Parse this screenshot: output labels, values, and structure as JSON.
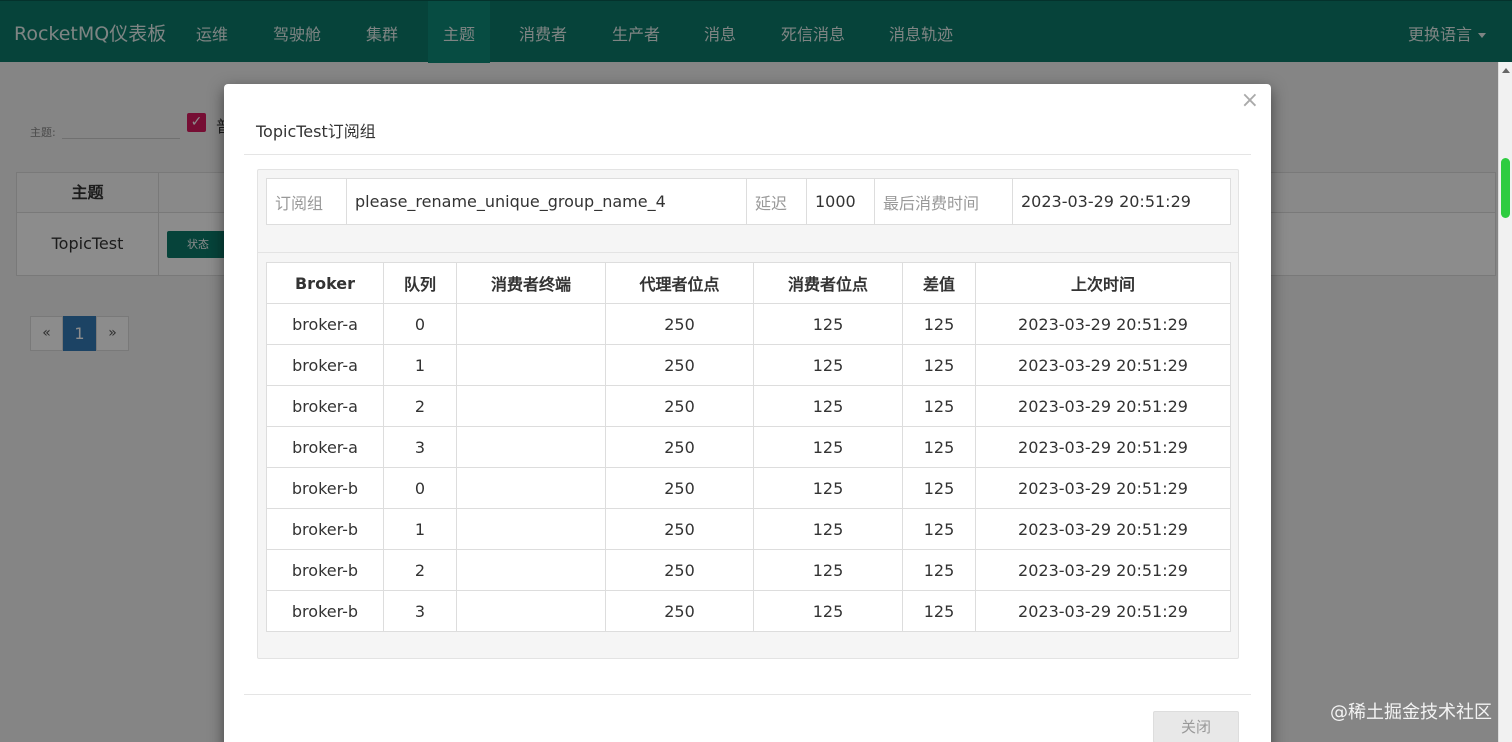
{
  "navbar": {
    "brand": "RocketMQ仪表板",
    "items": [
      "运维",
      "驾驶舱",
      "集群",
      "主题",
      "消费者",
      "生产者",
      "消息",
      "死信消息",
      "消息轨迹"
    ],
    "active_index": 3,
    "language": "更换语言"
  },
  "background": {
    "search_label": "主题:",
    "checkbox_label": "普",
    "table_header": "主题",
    "topic_name": "TopicTest",
    "status_button": "状态",
    "pagination": {
      "prev": "«",
      "current": "1",
      "next": "»"
    }
  },
  "modal": {
    "title": "TopicTest订阅组",
    "close_symbol": "×",
    "info": {
      "group_label": "订阅组",
      "group_value": "please_rename_unique_group_name_4",
      "delay_label": "延迟",
      "delay_value": "1000",
      "last_consume_label": "最后消费时间",
      "last_consume_value": "2023-03-29 20:51:29"
    },
    "columns": [
      "Broker",
      "队列",
      "消费者终端",
      "代理者位点",
      "消费者位点",
      "差值",
      "上次时间"
    ],
    "rows": [
      [
        "broker-a",
        "0",
        "",
        "250",
        "125",
        "125",
        "2023-03-29 20:51:29"
      ],
      [
        "broker-a",
        "1",
        "",
        "250",
        "125",
        "125",
        "2023-03-29 20:51:29"
      ],
      [
        "broker-a",
        "2",
        "",
        "250",
        "125",
        "125",
        "2023-03-29 20:51:29"
      ],
      [
        "broker-a",
        "3",
        "",
        "250",
        "125",
        "125",
        "2023-03-29 20:51:29"
      ],
      [
        "broker-b",
        "0",
        "",
        "250",
        "125",
        "125",
        "2023-03-29 20:51:29"
      ],
      [
        "broker-b",
        "1",
        "",
        "250",
        "125",
        "125",
        "2023-03-29 20:51:29"
      ],
      [
        "broker-b",
        "2",
        "",
        "250",
        "125",
        "125",
        "2023-03-29 20:51:29"
      ],
      [
        "broker-b",
        "3",
        "",
        "250",
        "125",
        "125",
        "2023-03-29 20:51:29"
      ]
    ],
    "close_button": "关闭"
  },
  "watermark": "@稀土掘金技术社区",
  "colors": {
    "navbar": "#0b7a6a",
    "accent_pink": "#d81b60",
    "pager_active": "#337ab7"
  }
}
